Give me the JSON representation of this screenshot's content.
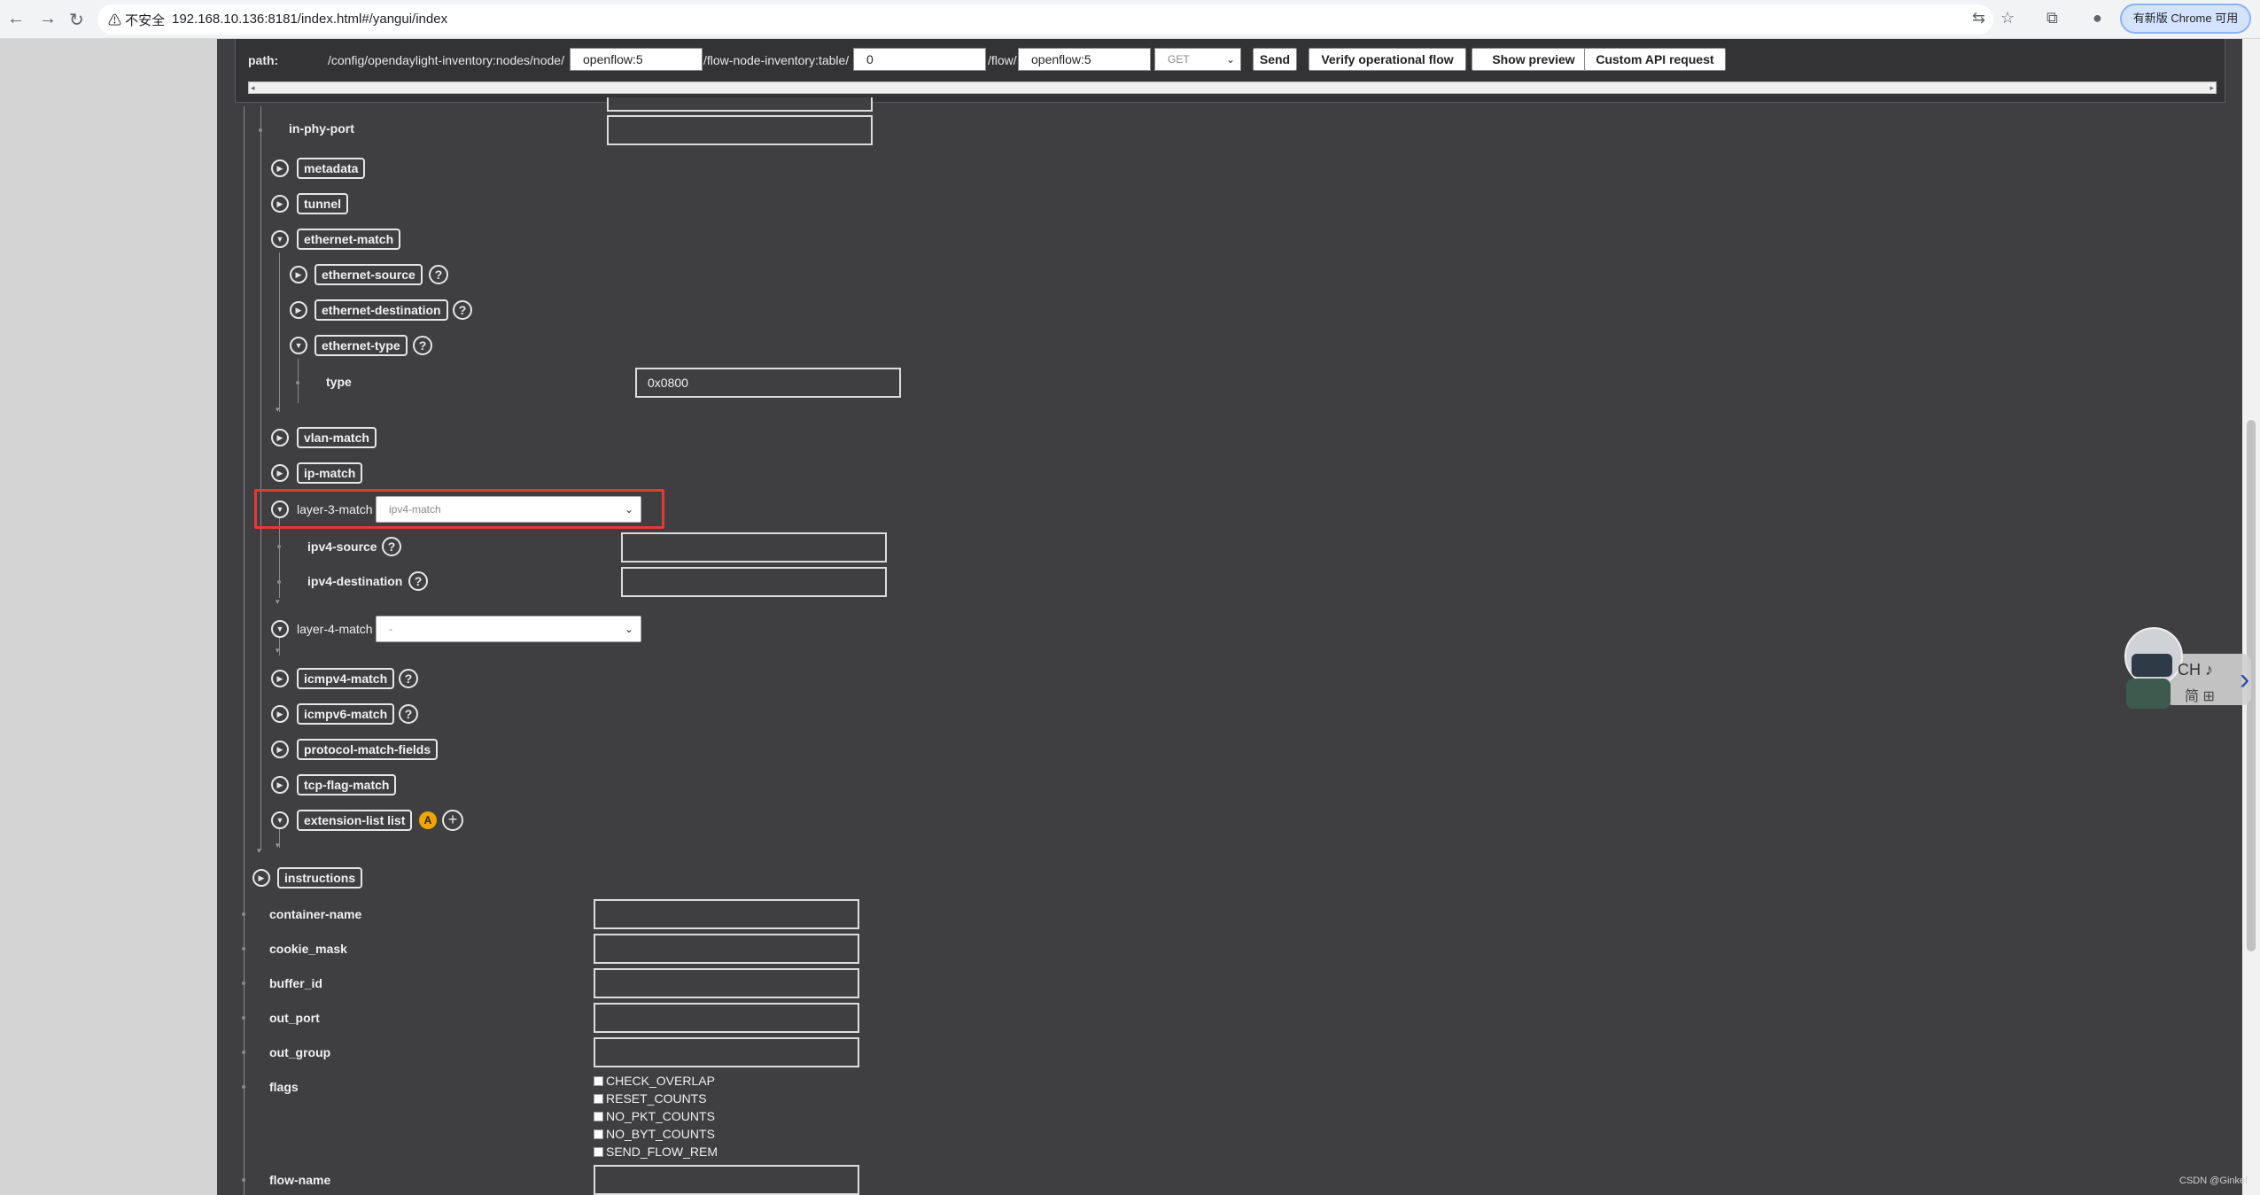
{
  "browser": {
    "security_label": "⚠ 不安全",
    "url": "192.168.10.136:8181/index.html#/yangui/index",
    "update_button": "有新版 Chrome 可用"
  },
  "path_bar": {
    "label": "path:",
    "segment1": "/config/opendaylight-inventory:nodes/node/",
    "node_value": "openflow:5",
    "segment2": "/flow-node-inventory:table/",
    "table_value": "0",
    "segment3": "/flow/",
    "flow_value": "openflow:5",
    "method": "GET",
    "send": "Send",
    "verify": "Verify operational flow",
    "preview": "Show preview",
    "custom": "Custom API request"
  },
  "tree": {
    "in_phy_port": "in-phy-port",
    "metadata": "metadata",
    "tunnel": "tunnel",
    "ethernet_match": "ethernet-match",
    "ethernet_source": "ethernet-source",
    "ethernet_destination": "ethernet-destination",
    "ethernet_type": "ethernet-type",
    "type_label": "type",
    "type_value": "0x0800",
    "vlan_match": "vlan-match",
    "ip_match": "ip-match",
    "layer3_label": "layer-3-match",
    "layer3_value": "ipv4-match",
    "ipv4_source": "ipv4-source",
    "ipv4_destination": "ipv4-destination",
    "layer4_label": "layer-4-match",
    "layer4_value": "-",
    "icmpv4_match": "icmpv4-match",
    "icmpv6_match": "icmpv6-match",
    "protocol_match_fields": "protocol-match-fields",
    "tcp_flag_match": "tcp-flag-match",
    "extension_list": "extension-list list",
    "instructions": "instructions",
    "container_name": "container-name",
    "cookie_mask": "cookie_mask",
    "buffer_id": "buffer_id",
    "out_port": "out_port",
    "out_group": "out_group",
    "flags": "flags",
    "flow_name": "flow-name"
  },
  "flags_options": [
    "CHECK_OVERLAP",
    "RESET_COUNTS",
    "NO_PKT_COUNTS",
    "NO_BYT_COUNTS",
    "SEND_FLOW_REM"
  ],
  "widget": {
    "line1": "CH ♪",
    "line2": "简 ⊞"
  },
  "watermark": "CSDN @Ginkel",
  "icons": {
    "help": "?",
    "expand": "▶",
    "collapse": "▼",
    "augment": "A",
    "add": "+"
  }
}
